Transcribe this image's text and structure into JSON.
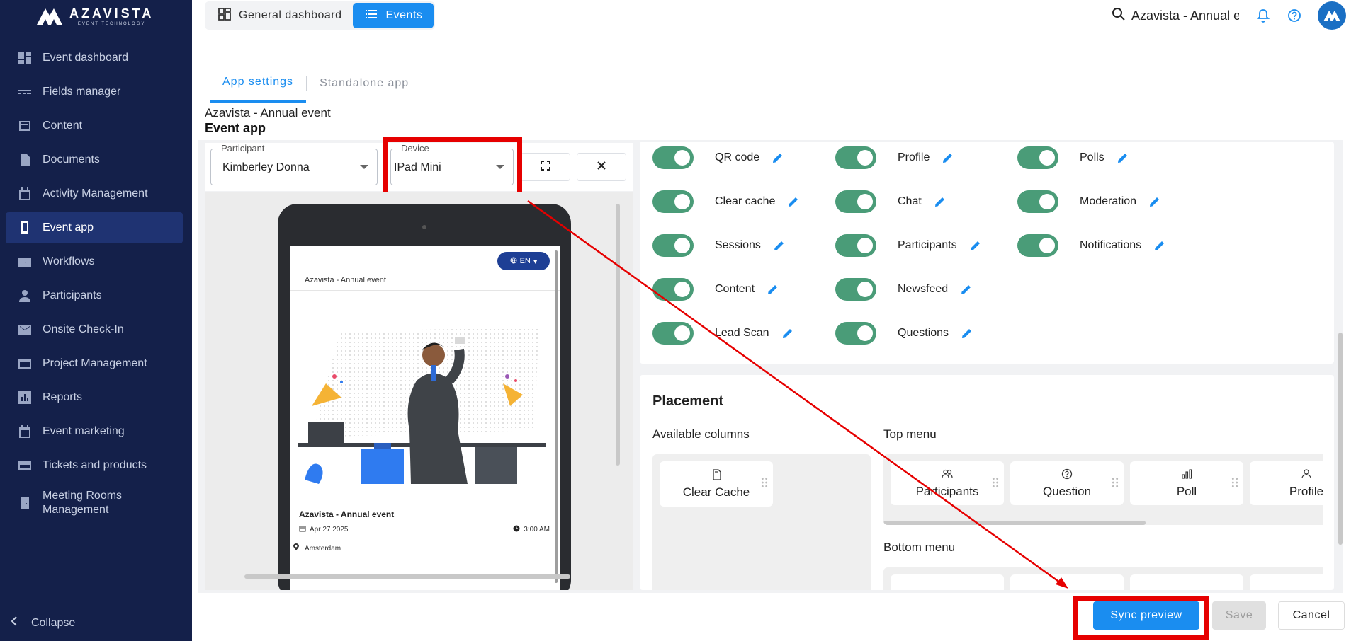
{
  "brand": {
    "name": "AZAVISTA",
    "tagline": "EVENT TECHNOLOGY"
  },
  "sidebar": {
    "items": [
      {
        "label": "Event dashboard",
        "icon": "dashboard-icon"
      },
      {
        "label": "Fields manager",
        "icon": "fields-icon"
      },
      {
        "label": "Content",
        "icon": "content-icon"
      },
      {
        "label": "Documents",
        "icon": "document-icon"
      },
      {
        "label": "Activity Management",
        "icon": "calendar-icon"
      },
      {
        "label": "Event app",
        "icon": "phone-icon",
        "active": true
      },
      {
        "label": "Workflows",
        "icon": "workflow-icon"
      },
      {
        "label": "Participants",
        "icon": "person-icon"
      },
      {
        "label": "Onsite Check-In",
        "icon": "mail-icon"
      },
      {
        "label": "Project Management",
        "icon": "project-icon"
      },
      {
        "label": "Reports",
        "icon": "reports-icon"
      },
      {
        "label": "Event marketing",
        "icon": "calendar-icon"
      },
      {
        "label": "Tickets and products",
        "icon": "card-icon"
      },
      {
        "label": "Meeting Rooms Management",
        "icon": "door-icon"
      }
    ],
    "collapse_label": "Collapse"
  },
  "topbar": {
    "tabs": [
      {
        "label": "General dashboard",
        "icon": "grid-icon"
      },
      {
        "label": "Events",
        "icon": "list-icon",
        "active": true
      }
    ],
    "search_text": "Azavista - Annual event"
  },
  "subtabs": [
    {
      "label": "App settings",
      "active": true
    },
    {
      "label": "Standalone app"
    }
  ],
  "header": {
    "breadcrumb": "Azavista - Annual event",
    "title": "Event app"
  },
  "preview": {
    "participant_label": "Participant",
    "participant_value": "Kimberley Donna",
    "device_label": "Device",
    "device_value": "IPad Mini",
    "screen": {
      "language": "EN",
      "event_header": "Azavista - Annual event",
      "event_title": "Azavista - Annual event",
      "date": "Apr 27 2025",
      "time": "3:00 AM",
      "location": "Amsterdam"
    }
  },
  "modules": [
    {
      "label": "QR code",
      "enabled": true
    },
    {
      "label": "Profile",
      "enabled": true
    },
    {
      "label": "Polls",
      "enabled": true
    },
    {
      "label": "Clear cache",
      "enabled": true
    },
    {
      "label": "Chat",
      "enabled": true
    },
    {
      "label": "Moderation",
      "enabled": true
    },
    {
      "label": "Sessions",
      "enabled": true
    },
    {
      "label": "Participants",
      "enabled": true
    },
    {
      "label": "Notifications",
      "enabled": true
    },
    {
      "label": "Content",
      "enabled": true
    },
    {
      "label": "Newsfeed",
      "enabled": true
    },
    {
      "label": "Lead Scan",
      "enabled": true
    },
    {
      "label": "Questions",
      "enabled": true
    }
  ],
  "placement": {
    "title": "Placement",
    "available_label": "Available columns",
    "available": [
      {
        "label": "Clear Cache",
        "icon": "sd-card-icon"
      }
    ],
    "top_menu_label": "Top menu",
    "top_menu": [
      {
        "label": "Participants",
        "icon": "people-icon"
      },
      {
        "label": "Question",
        "icon": "question-icon"
      },
      {
        "label": "Poll",
        "icon": "poll-icon"
      },
      {
        "label": "Profile",
        "icon": "person-icon"
      }
    ],
    "bottom_menu_label": "Bottom menu"
  },
  "footer": {
    "sync_label": "Sync preview",
    "save_label": "Save",
    "cancel_label": "Cancel"
  },
  "colors": {
    "sidebar_bg": "#14204a",
    "accent": "#1a8df0",
    "toggle_on": "#4a9c78",
    "annotation_red": "#e60000"
  }
}
